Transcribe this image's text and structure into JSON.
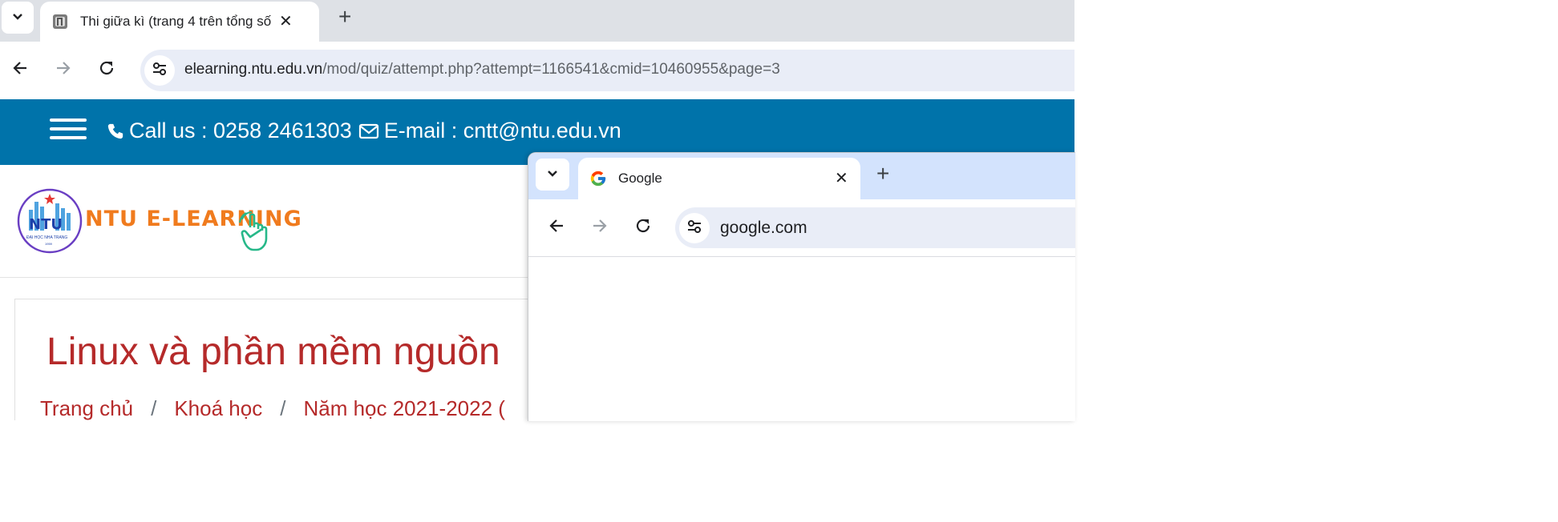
{
  "back_window": {
    "tab": {
      "title": "Thi giữa kì (trang 4 trên tổng số",
      "close_label": "✕"
    },
    "new_tab_label": "+",
    "address": {
      "host": "elearning.ntu.edu.vn",
      "path": "/mod/quiz/attempt.php?attempt=1166541&cmid=10460955&page=3"
    },
    "site_header": {
      "phone_text": "Call us : 0258 2461303",
      "email_text": "E-mail : cntt@ntu.edu.vn"
    },
    "logo": {
      "emblem_text": "NTU",
      "emblem_subtext": "ĐẠI HỌC NHA TRANG",
      "emblem_year": "1959",
      "brand_text": "NTU E-LEARNING"
    },
    "page": {
      "course_title": "Linux và phần mềm nguồn",
      "breadcrumb": [
        "Trang chủ",
        "Khoá học",
        "Năm học 2021-2022 ("
      ],
      "breadcrumb_separator": "/"
    }
  },
  "front_window": {
    "tab": {
      "title": "Google",
      "close_label": "✕"
    },
    "new_tab_label": "+",
    "address": {
      "url": "google.com"
    }
  },
  "colors": {
    "site_header_bg": "#0073aa",
    "accent_red": "#b52a2a",
    "logo_orange": "#f07b1e",
    "tabstrip_back": "#dee1e6",
    "tabstrip_front": "#d3e3fd"
  }
}
